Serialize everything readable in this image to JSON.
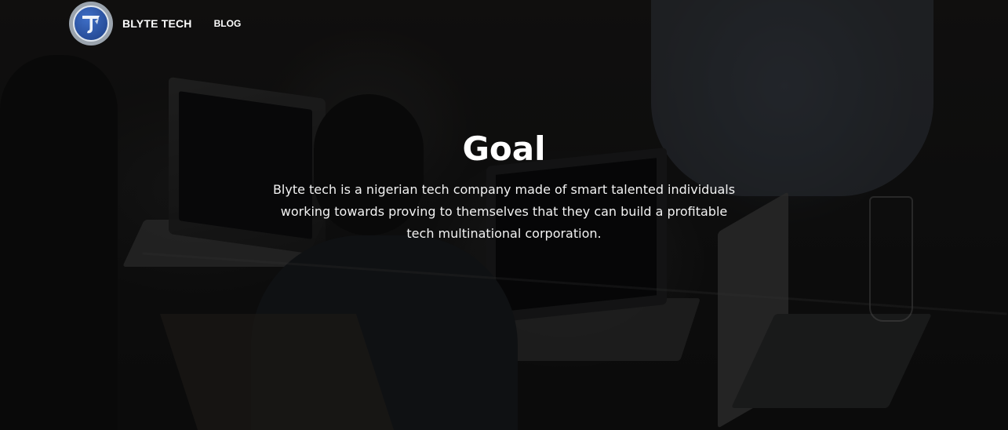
{
  "nav": {
    "brand": "BLYTE TECH",
    "links": [
      {
        "label": "BLOG"
      }
    ],
    "logo_icon": "blyte-tech-logo-icon",
    "colors": {
      "logo_ring": "#9aa3ad",
      "logo_fill": "#2a56a8"
    }
  },
  "hero": {
    "title": "Goal",
    "description": "Blyte tech is a nigerian tech company made of smart talented individuals working towards proving to themselves that they can build a profitable tech multinational corporation.",
    "background": "dark photo of people working on laptops around a table"
  }
}
